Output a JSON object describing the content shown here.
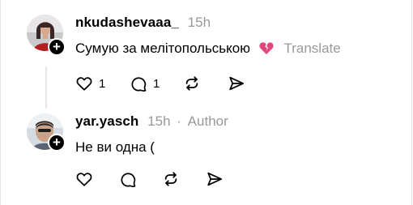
{
  "comments": [
    {
      "username": "nkudashevaaa_",
      "time": "15h",
      "text": "Сумую за мелітопольською",
      "emoji": "broken-heart",
      "translate_label": "Translate",
      "like_count": "1",
      "reply_count": "1",
      "avatar_icon": "user-photo-avatar",
      "follow_icon": "plus-icon"
    },
    {
      "username": "yar.yasch",
      "time": "15h",
      "separator": "·",
      "author_label": "Author",
      "text": "Не ви одна (",
      "avatar_icon": "user-photo-avatar",
      "follow_icon": "plus-icon"
    }
  ],
  "icons": {
    "like": "heart-outline-icon",
    "reply": "comment-bubble-icon",
    "repost": "repost-arrows-icon",
    "share": "send-icon"
  },
  "colors": {
    "text": "#000000",
    "muted": "#999999",
    "thread_line": "#e6e6e6",
    "broken_heart": "#e0457b"
  }
}
